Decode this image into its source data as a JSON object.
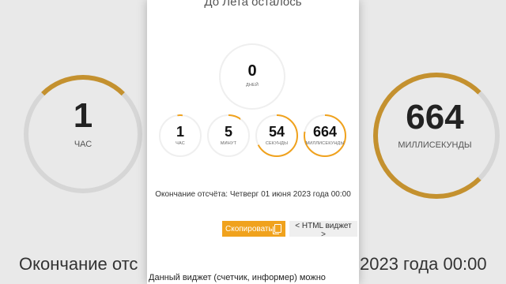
{
  "background": {
    "left": {
      "value": "1",
      "label": "ЧАС"
    },
    "right": {
      "value": "664",
      "label": "МИЛЛИСЕКУНДЫ"
    },
    "bottom_left_text": "Окончание отс",
    "bottom_right_text": "2023 года 00:00"
  },
  "widget": {
    "title": "До Лета осталось",
    "days": {
      "value": "0",
      "label": "ДНЕЙ"
    },
    "hours": {
      "value": "1",
      "label": "ЧАС"
    },
    "minutes": {
      "value": "5",
      "label": "МИНУТ"
    },
    "seconds": {
      "value": "54",
      "label": "СЕКУНДЫ"
    },
    "milliseconds": {
      "value": "664",
      "label": "МИЛЛИСЕКУНДЫ"
    },
    "end_text": "Окончание отсчёта: Четверг 01 июня 2023 года 00:00",
    "copy_button": "Скопировать",
    "html_button": "< HTML виджет >",
    "footer_text": "Данный виджет (счетчик, информер) можно"
  },
  "colors": {
    "accent": "#f0a21d",
    "ring": "#efefef"
  }
}
